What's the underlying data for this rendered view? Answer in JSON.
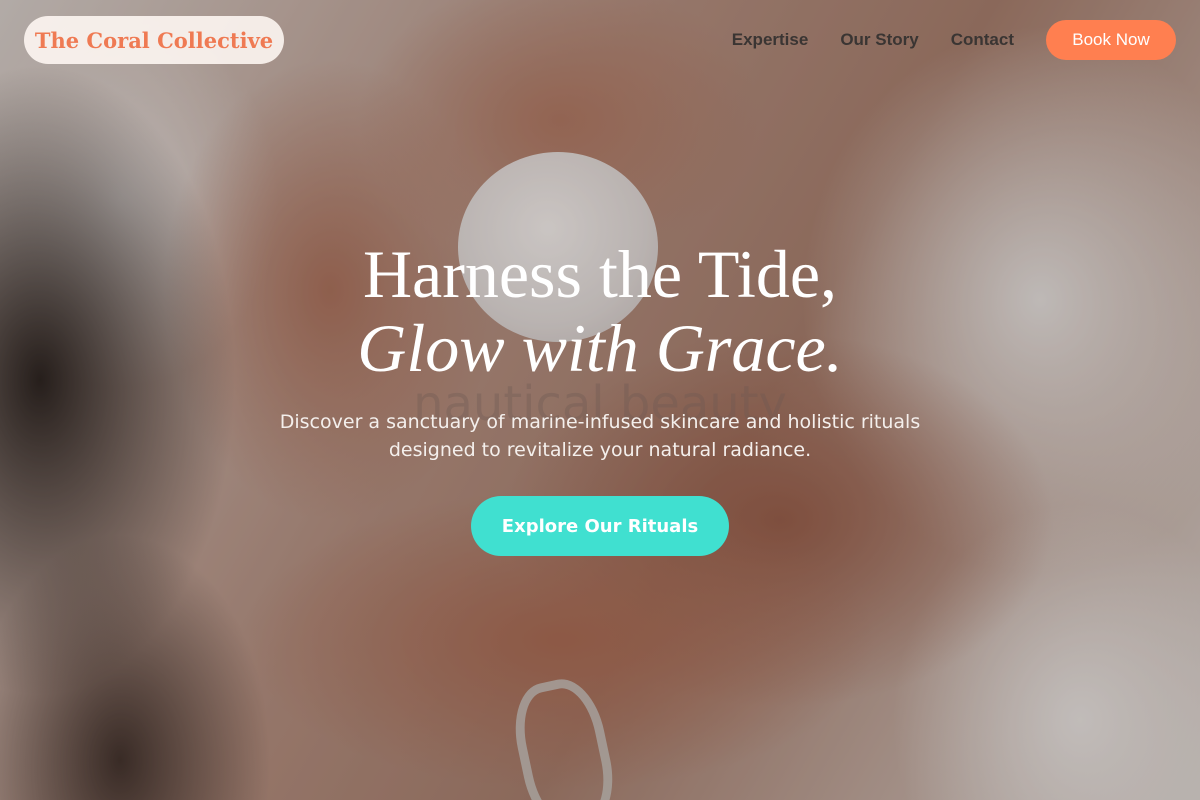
{
  "header": {
    "brand": "The Coral Collective",
    "nav": [
      {
        "label": "Expertise"
      },
      {
        "label": "Our Story"
      },
      {
        "label": "Contact"
      }
    ],
    "book_label": "Book Now"
  },
  "hero": {
    "title_line1": "Harness the Tide,",
    "title_line2": "Glow with Grace.",
    "watermark": "nautical beauty",
    "subtitle": "Discover a sanctuary of marine-infused skincare and holistic rituals designed to revitalize your natural radiance.",
    "cta_label": "Explore Our Rituals"
  },
  "colors": {
    "brand_coral": "#ff7f50",
    "accent_turquoise": "#40e0d0",
    "text_white": "#ffffff"
  }
}
